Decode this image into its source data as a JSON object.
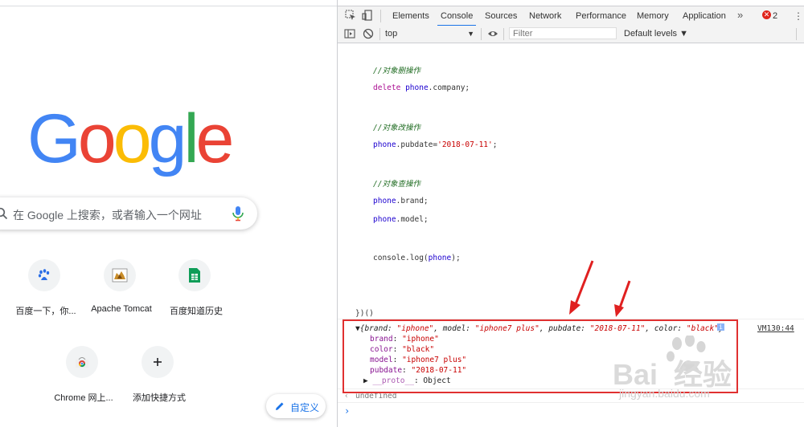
{
  "ntp": {
    "logo_letters": [
      {
        "ch": "G",
        "color": "#4285F4"
      },
      {
        "ch": "o",
        "color": "#EA4335"
      },
      {
        "ch": "o",
        "color": "#FBBC05"
      },
      {
        "ch": "g",
        "color": "#4285F4"
      },
      {
        "ch": "l",
        "color": "#34A853"
      },
      {
        "ch": "e",
        "color": "#EA4335"
      }
    ],
    "search_placeholder": "在 Google 上搜索，或者输入一个网址",
    "shortcuts": [
      {
        "label": "百度一下，你...",
        "icon": "baidu-paw-icon"
      },
      {
        "label": "Apache Tomcat",
        "icon": "tomcat-icon"
      },
      {
        "label": "百度知道历史",
        "icon": "sheet-icon"
      },
      {
        "label": "Chrome 网上...",
        "icon": "chrome-store-icon"
      },
      {
        "label": "添加快捷方式",
        "icon": "plus-icon"
      }
    ],
    "customize_label": "自定义"
  },
  "devtools": {
    "tabs": [
      "Elements",
      "Console",
      "Sources",
      "Network",
      "Performance",
      "Memory",
      "Application"
    ],
    "active_tab": "Console",
    "more_tabs": "»",
    "error_count": "2",
    "context": "top",
    "filter_placeholder": "Filter",
    "levels": "Default levels ▼",
    "code": {
      "c1": "//对象删操作",
      "delete_kw": "delete",
      "delete_obj": "phone",
      "delete_rest": ".company;",
      "c2": "//对象改操作",
      "upd_obj": "phone",
      "upd_prop": ".pubdate=",
      "upd_val": "'2018-07-11'",
      "upd_end": ";",
      "c3": "//对象查操作",
      "q1_obj": "phone",
      "q1_rest": ".brand;",
      "q2_obj": "phone",
      "q2_rest": ".model;",
      "log_pre": "console.log(",
      "log_obj": "phone",
      "log_post": ");",
      "close": "})()"
    },
    "output": {
      "summary_open": "{brand: ",
      "summary_brand": "\"iphone\"",
      "summary_m": ", model: ",
      "summary_model": "\"iphone7 plus\"",
      "summary_p": ", pubdate: ",
      "summary_pubdate": "\"2018-07-11\"",
      "summary_c": ", color: ",
      "summary_color": "\"black\"",
      "summary_close": "}",
      "source_link": "VM130:44",
      "props": [
        {
          "key": "brand",
          "value": "\"iphone\""
        },
        {
          "key": "color",
          "value": "\"black\""
        },
        {
          "key": "model",
          "value": "\"iphone7 plus\""
        },
        {
          "key": "pubdate",
          "value": "\"2018-07-11\""
        }
      ],
      "proto_key": "__proto__",
      "proto_val": ": Object",
      "return_arrow": "‹",
      "return_value": "undefined",
      "prompt": "›"
    }
  },
  "watermark": {
    "text": "Bai  经验",
    "sub": "jingyan.baidu.com"
  },
  "colors": {
    "highlight_box": "#e03030",
    "tab_underline": "#1a73e8"
  }
}
